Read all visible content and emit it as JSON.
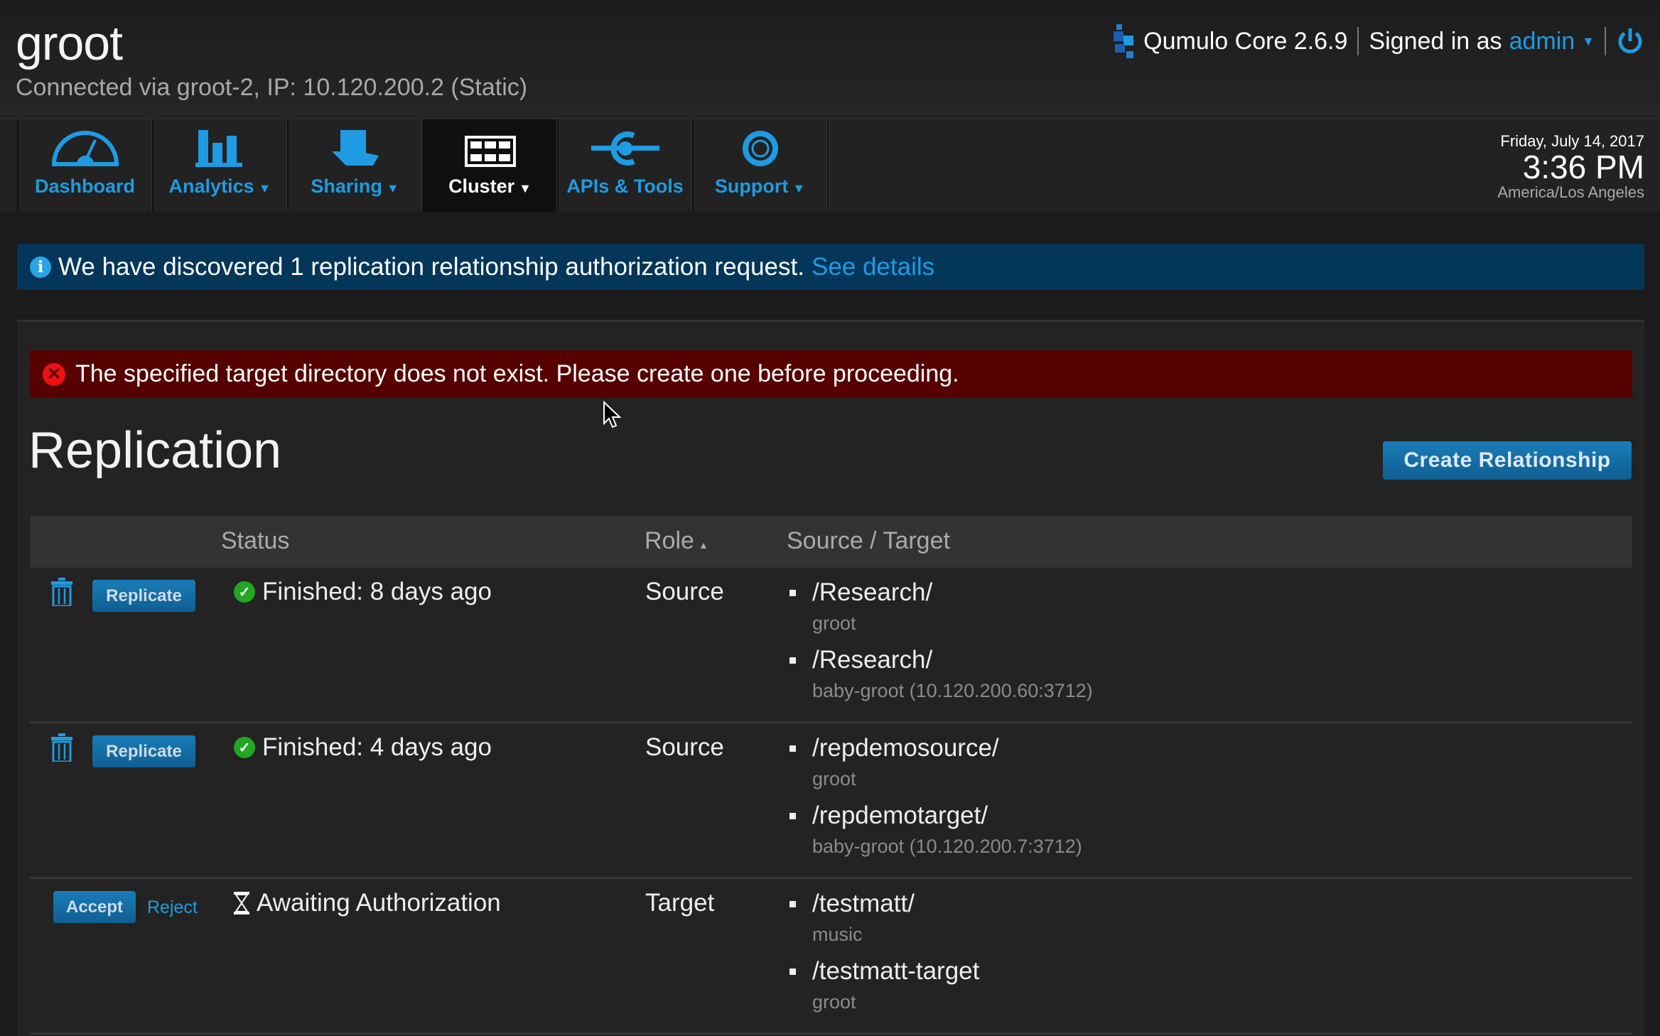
{
  "header": {
    "host": "groot",
    "connection": "Connected via groot-2, IP: 10.120.200.2 (Static)",
    "product": "Qumulo Core 2.6.9",
    "signed_in_label": "Signed in as",
    "user": "admin"
  },
  "nav": [
    {
      "label": "Dashboard",
      "icon": "dashboard-gauge-icon"
    },
    {
      "label": "Analytics",
      "icon": "bar-chart-icon"
    },
    {
      "label": "Sharing",
      "icon": "sharing-hand-icon"
    },
    {
      "label": "Cluster",
      "icon": "cluster-grid-icon",
      "active": true
    },
    {
      "label": "APIs & Tools",
      "icon": "api-plug-icon"
    },
    {
      "label": "Support",
      "icon": "lifebuoy-icon"
    }
  ],
  "datetime": {
    "date": "Friday, July 14, 2017",
    "time": "3:36 PM",
    "timezone": "America/Los Angeles"
  },
  "info_banner": {
    "text": "We have discovered 1 replication relationship authorization request.",
    "link": "See details"
  },
  "error_banner": {
    "text": "The specified target directory does not exist. Please create one before proceeding."
  },
  "main": {
    "title": "Replication",
    "create_button": "Create Relationship",
    "columns": {
      "status": "Status",
      "role": "Role",
      "source_target": "Source / Target"
    },
    "rows": [
      {
        "action": "Replicate",
        "status": "Finished: 8 days ago",
        "role": "Source",
        "entries": [
          {
            "path": "/Research/",
            "host": "groot"
          },
          {
            "path": "/Research/",
            "host": "baby-groot (10.120.200.60:3712)"
          }
        ]
      },
      {
        "action": "Replicate",
        "status": "Finished: 4 days ago",
        "role": "Source",
        "entries": [
          {
            "path": "/repdemosource/",
            "host": "groot"
          },
          {
            "path": "/repdemotarget/",
            "host": "baby-groot (10.120.200.7:3712)"
          }
        ]
      },
      {
        "action": "Accept",
        "secondary_action": "Reject",
        "status": "Awaiting Authorization",
        "role": "Target",
        "entries": [
          {
            "path": "/testmatt/",
            "host": "music"
          },
          {
            "path": "/testmatt-target",
            "host": "groot"
          }
        ]
      }
    ]
  },
  "colors": {
    "accent": "#1e9be2",
    "info_bg": "#04365a",
    "error_bg": "#560000",
    "success": "#23a623"
  }
}
